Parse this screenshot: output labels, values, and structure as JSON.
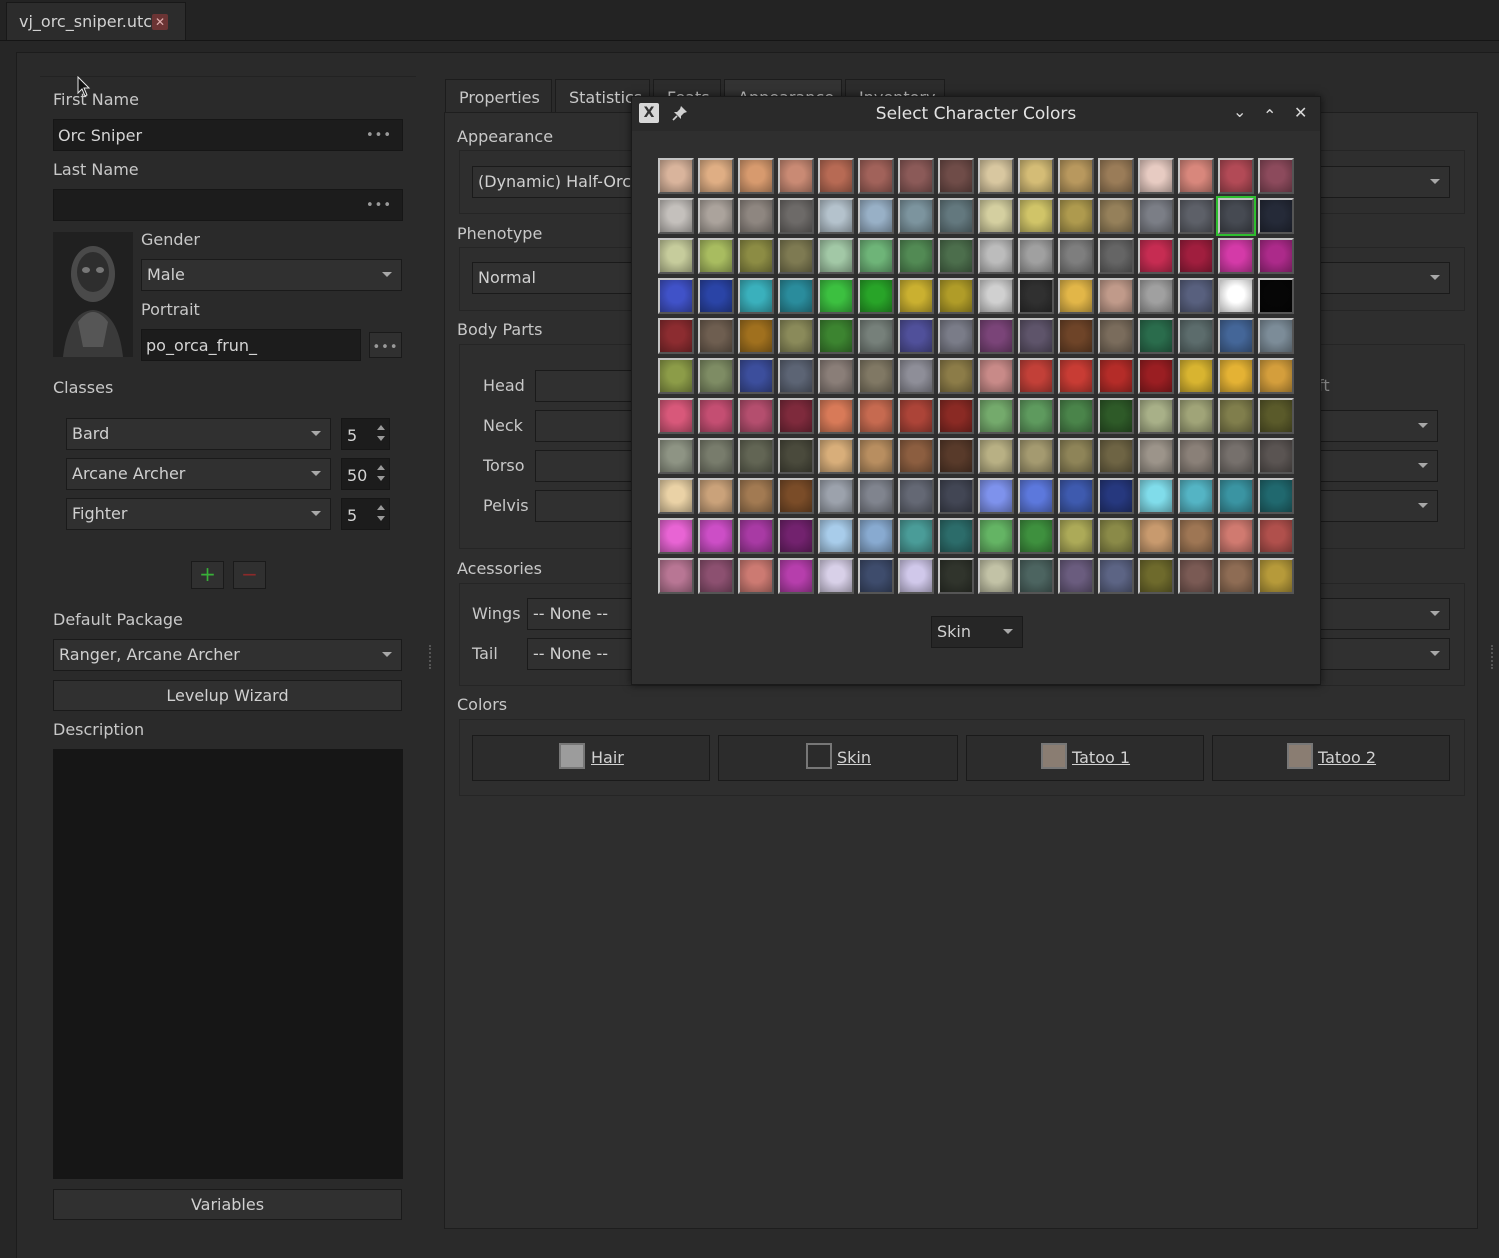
{
  "file_tab": {
    "title": "vj_orc_sniper.utc",
    "close": "✕"
  },
  "left": {
    "first_name_label": "First Name",
    "first_name_value": "Orc Sniper",
    "last_name_label": "Last Name",
    "last_name_value": "",
    "ellipsis": "•••",
    "gender_label": "Gender",
    "gender_value": "Male",
    "portrait_label": "Portrait",
    "portrait_value": "po_orca_frun_",
    "classes_label": "Classes",
    "classes": [
      {
        "name": "Bard",
        "level": "5"
      },
      {
        "name": "Arcane Archer",
        "level": "50"
      },
      {
        "name": "Fighter",
        "level": "5"
      }
    ],
    "add_symbol": "+",
    "remove_symbol": "−",
    "default_package_label": "Default Package",
    "default_package_value": "Ranger, Arcane Archer",
    "levelup_button": "Levelup Wizard",
    "description_label": "Description",
    "description_value": "",
    "variables_button": "Variables"
  },
  "tabs": [
    "Properties",
    "Statistics",
    "Feats",
    "Appearance",
    "Inventory"
  ],
  "appearance": {
    "appearance_label": "Appearance",
    "appearance_value": "(Dynamic) Half-Orc",
    "phenotype_label": "Phenotype",
    "phenotype_value": "Normal",
    "body_parts_label": "Body Parts",
    "body_parts": [
      "Head",
      "Neck",
      "Torso",
      "Pelvis"
    ],
    "right_partial_label": "ft",
    "accessories_label": "Acessories",
    "wings_label": "Wings",
    "wings_value": "-- None --",
    "tail_label": "Tail",
    "tail_value": "-- None --",
    "colors_label": "Colors",
    "color_buttons": [
      {
        "label": "Hair",
        "chip": "#9c9c9c"
      },
      {
        "label": "Skin",
        "chip": "#2b2b2b"
      },
      {
        "label": "Tatoo 1",
        "chip": "#8a7d72"
      },
      {
        "label": "Tatoo 2",
        "chip": "#8a7d72"
      }
    ]
  },
  "dialog": {
    "title": "Select Character Colors",
    "app_icon": "X",
    "pin_icon": "pin-icon",
    "controls": [
      "⌄",
      "⌃",
      "✕"
    ],
    "channel_value": "Skin",
    "selected_row": 1,
    "selected_col": 14,
    "palette": [
      [
        "#d9b49c",
        "#dfae84",
        "#d79a6e",
        "#c98a74",
        "#b76a54",
        "#a1625a",
        "#8b5a58",
        "#6f4c48",
        "#d8c7a0",
        "#d4bc76",
        "#b8985e",
        "#9a7c58",
        "#e7cbc2",
        "#d8877c",
        "#b24a56",
        "#8c4a5c"
      ],
      [
        "#c4c0bc",
        "#aba39c",
        "#8e8680",
        "#6d6a68",
        "#b4c2cc",
        "#98b0c6",
        "#7c949e",
        "#63787e",
        "#d4cfa0",
        "#d0c468",
        "#ae9a4e",
        "#95805a",
        "#7b7e86",
        "#5d6068",
        "#464a52",
        "#252a38"
      ],
      [
        "#c6cc9c",
        "#a8bc60",
        "#8c8c44",
        "#7e7a52",
        "#a2c8a6",
        "#6eb478",
        "#528a54",
        "#4c6e4c",
        "#bcbcbc",
        "#a0a0a0",
        "#7e7e7e",
        "#656565",
        "#c62c52",
        "#a01e3e",
        "#d43aa8",
        "#ac2a8a"
      ],
      [
        "#4052c8",
        "#2a44a6",
        "#3ab0bc",
        "#2a8c9c",
        "#3cc040",
        "#28a428",
        "#cab030",
        "#b09c28",
        "#d0d0d0",
        "#303030",
        "#e2b648",
        "#c09a8a",
        "#a0a0a0",
        "#58607e",
        "#ffffff",
        "#060606"
      ],
      [
        "#8c2c30",
        "#6e5e50",
        "#a0701e",
        "#8a8a5a",
        "#3c8430",
        "#76807a",
        "#50509a",
        "#7a7c88",
        "#7a4478",
        "#5e546a",
        "#6e4428",
        "#7a6c5c",
        "#2a6c4c",
        "#5c6c6c",
        "#446698",
        "#7c8c98"
      ],
      [
        "#8c9c48",
        "#7e8c64",
        "#3c4e9c",
        "#5c6474",
        "#8a7e78",
        "#807864",
        "#8e8e98",
        "#8c7c48",
        "#c88a88",
        "#c24038",
        "#c83c34",
        "#b42c28",
        "#9a1e22",
        "#d8b430",
        "#e4b234",
        "#d49e3c"
      ],
      [
        "#d8587a",
        "#c44e72",
        "#b44e6e",
        "#7e2a3c",
        "#d87a58",
        "#c66a50",
        "#ac4438",
        "#8a2a24",
        "#74aa6c",
        "#5e9a5e",
        "#4a844a",
        "#2e5a28",
        "#a8b088",
        "#a0a478",
        "#807e4c",
        "#5a5a2a"
      ],
      [
        "#8e9484",
        "#787c6c",
        "#626554",
        "#4a4a3c",
        "#d8ae7a",
        "#b88e60",
        "#8c5e40",
        "#583a2a",
        "#b8b084",
        "#a49a70",
        "#8e8458",
        "#6e6444",
        "#9c948a",
        "#8a8078",
        "#76706c",
        "#5a5452"
      ],
      [
        "#ead2a6",
        "#caa27a",
        "#a27a52",
        "#7a4c28",
        "#9ca2ac",
        "#80848e",
        "#646874",
        "#424654",
        "#7e92ec",
        "#5c78dc",
        "#3e5aae",
        "#26387e",
        "#80dcea",
        "#54b4c4",
        "#3a94a2",
        "#20686e"
      ],
      [
        "#e864d4",
        "#cc4ec6",
        "#a83aa4",
        "#72226e",
        "#a8ccea",
        "#88aad0",
        "#4a9c98",
        "#2c6c6a",
        "#64b464",
        "#3e903e",
        "#acaa58",
        "#8a8a48",
        "#c89a6e",
        "#9e7654",
        "#d07a70",
        "#b0504c"
      ],
      [
        "#b87694",
        "#8c5070",
        "#cc7a72",
        "#b63eac",
        "#d8d0e8",
        "#3e4c6c",
        "#d0c8ea",
        "#30342c",
        "#c2c2a6",
        "#4c6460",
        "#6a5c7e",
        "#5c6484",
        "#6e6a2c",
        "#7a5a54",
        "#8e6c54",
        "#b69a3a"
      ]
    ]
  }
}
